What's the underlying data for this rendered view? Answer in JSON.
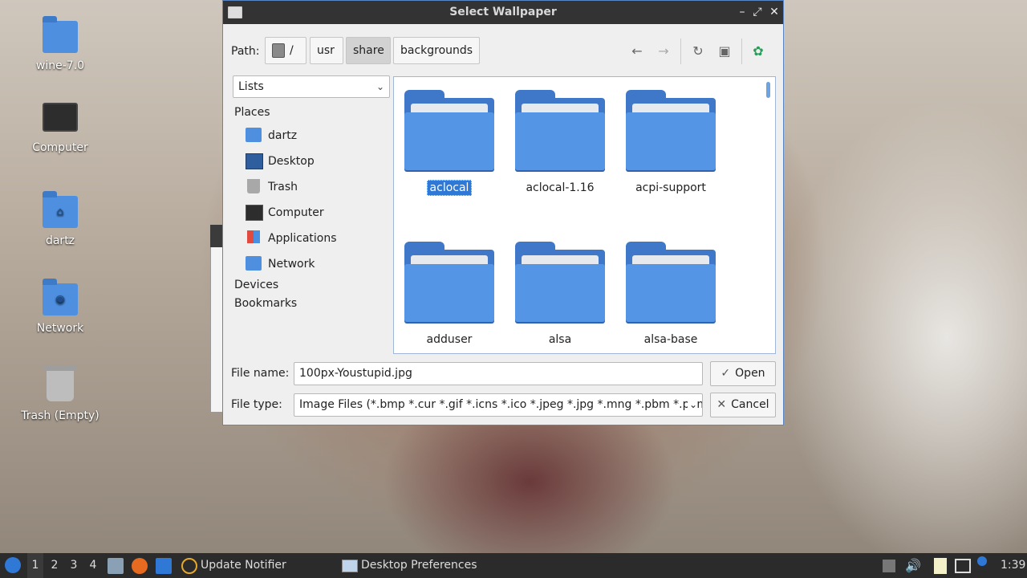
{
  "desktop": {
    "icons": [
      {
        "label": "wine-7.0",
        "icon": "folder-icon"
      },
      {
        "label": "Computer",
        "icon": "computer-icon"
      },
      {
        "label": "dartz",
        "icon": "home-folder-icon"
      },
      {
        "label": "Network",
        "icon": "network-folder-icon"
      },
      {
        "label": "Trash (Empty)",
        "icon": "trash-icon"
      }
    ]
  },
  "dialog": {
    "title": "Select Wallpaper",
    "path_label": "Path:",
    "breadcrumbs": [
      "/",
      "usr",
      "share",
      "backgrounds"
    ],
    "active_crumb": "share",
    "view_combo": "Lists",
    "places_header": "Places",
    "places": [
      "dartz",
      "Desktop",
      "Trash",
      "Computer",
      "Applications",
      "Network"
    ],
    "devices_header": "Devices",
    "bookmarks_header": "Bookmarks",
    "files": [
      "aclocal",
      "aclocal-1.16",
      "acpi-support",
      "adduser",
      "alsa",
      "alsa-base"
    ],
    "selected_file": "aclocal",
    "file_name_label": "File name:",
    "file_name_value": "100px-Youstupid.jpg",
    "file_type_label": "File type:",
    "file_type_value": "Image Files (*.bmp *.cur *.gif *.icns *.ico *.jpeg *.jpg *.mng *.pbm *.pgm",
    "open_label": "Open",
    "cancel_label": "Cancel"
  },
  "taskbar": {
    "workspaces": [
      "1",
      "2",
      "3",
      "4"
    ],
    "active_workspace": "1",
    "tasks": [
      "Update Notifier",
      "Desktop Preferences"
    ],
    "clock": "1:39"
  },
  "colors": {
    "accent": "#2f78d6",
    "folder": "#5595e6",
    "titlebar": "#333333",
    "taskbar": "#2b2b2b"
  }
}
